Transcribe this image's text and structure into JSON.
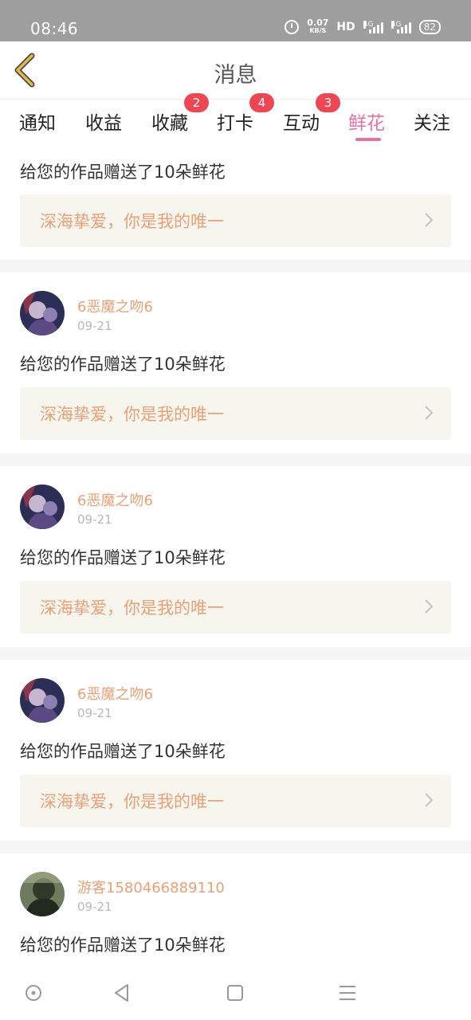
{
  "status_bar": {
    "time": "08:46",
    "net_speed_value": "0.07",
    "net_speed_unit": "KB/S",
    "hd": "HD",
    "sim1": "4G",
    "sim2": "4G",
    "battery": "82"
  },
  "header": {
    "title": "消息"
  },
  "tabs": [
    {
      "label": "通知"
    },
    {
      "label": "收益"
    },
    {
      "label": "收藏",
      "badge": "2"
    },
    {
      "label": "打卡",
      "badge": "4"
    },
    {
      "label": "互动",
      "badge": "3"
    },
    {
      "label": "鲜花",
      "active": true
    },
    {
      "label": "关注"
    }
  ],
  "first_item": {
    "message": "给您的作品赠送了10朵鲜花",
    "work_title": "深海挚爱，你是我的唯一"
  },
  "items": [
    {
      "user": "6恶魔之吻6",
      "date": "09-21",
      "message": "给您的作品赠送了10朵鲜花",
      "work_title": "深海挚爱，你是我的唯一"
    },
    {
      "user": "6恶魔之吻6",
      "date": "09-21",
      "message": "给您的作品赠送了10朵鲜花",
      "work_title": "深海挚爱，你是我的唯一"
    },
    {
      "user": "6恶魔之吻6",
      "date": "09-21",
      "message": "给您的作品赠送了10朵鲜花",
      "work_title": "深海挚爱，你是我的唯一"
    },
    {
      "user": "游客1580466889110",
      "date": "09-21",
      "message": "给您的作品赠送了10朵鲜花"
    }
  ],
  "colors": {
    "accent_pink": "#e472a3",
    "badge_red": "#ee4753",
    "orange_text": "#e9a077",
    "card_bg": "#f6f5ee",
    "back_arrow": "#e2b84a"
  },
  "icons": {
    "back": "chevron-left-icon",
    "card_arrow": "chevron-right-icon",
    "nav": [
      "home-circle-icon",
      "back-triangle-icon",
      "recents-square-icon",
      "menu-lines-icon"
    ]
  }
}
